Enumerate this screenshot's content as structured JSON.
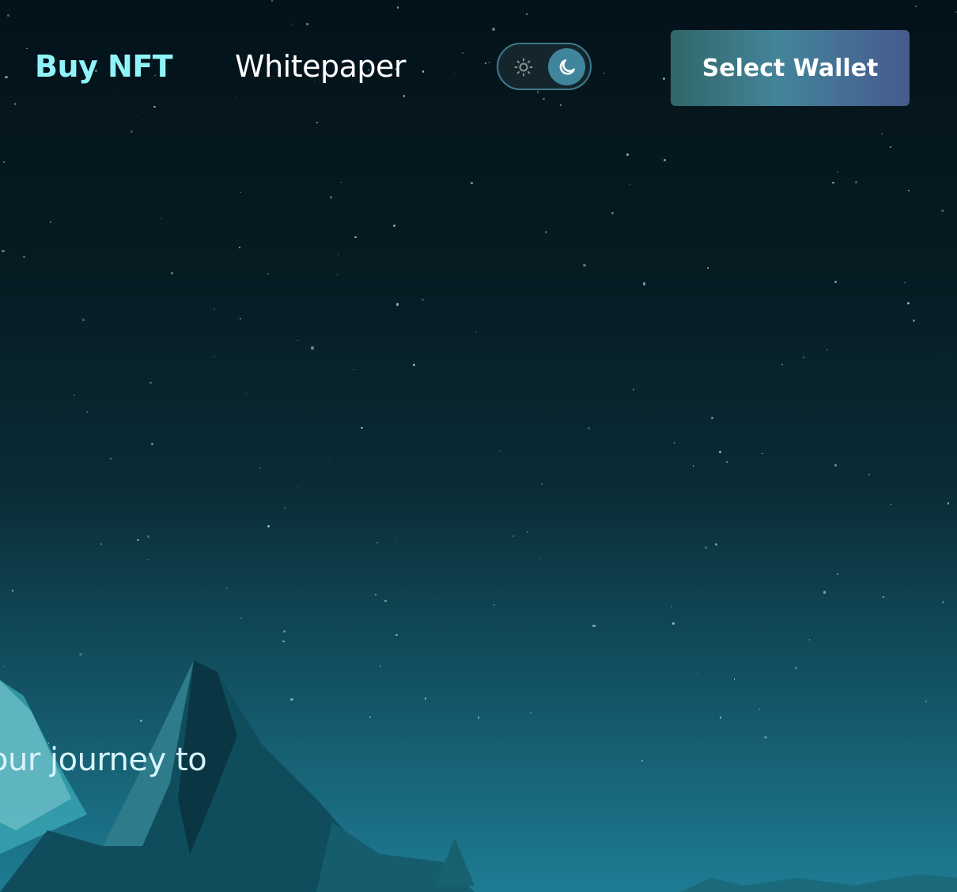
{
  "nav": {
    "buy_nft": "Buy NFT",
    "whitepaper": "Whitepaper"
  },
  "theme_toggle": {
    "options": [
      "light",
      "dark"
    ],
    "selected": "dark",
    "icons": [
      "sun-icon",
      "moon-icon"
    ]
  },
  "wallet_button": {
    "label": "Select Wallet"
  },
  "hero": {
    "text_visible": "our journey to"
  },
  "colors": {
    "accent": "#8ff3f8",
    "toggle_knob": "#3f869d",
    "wallet_gradient": [
      "#306767",
      "#44849a",
      "#465a8e"
    ]
  }
}
